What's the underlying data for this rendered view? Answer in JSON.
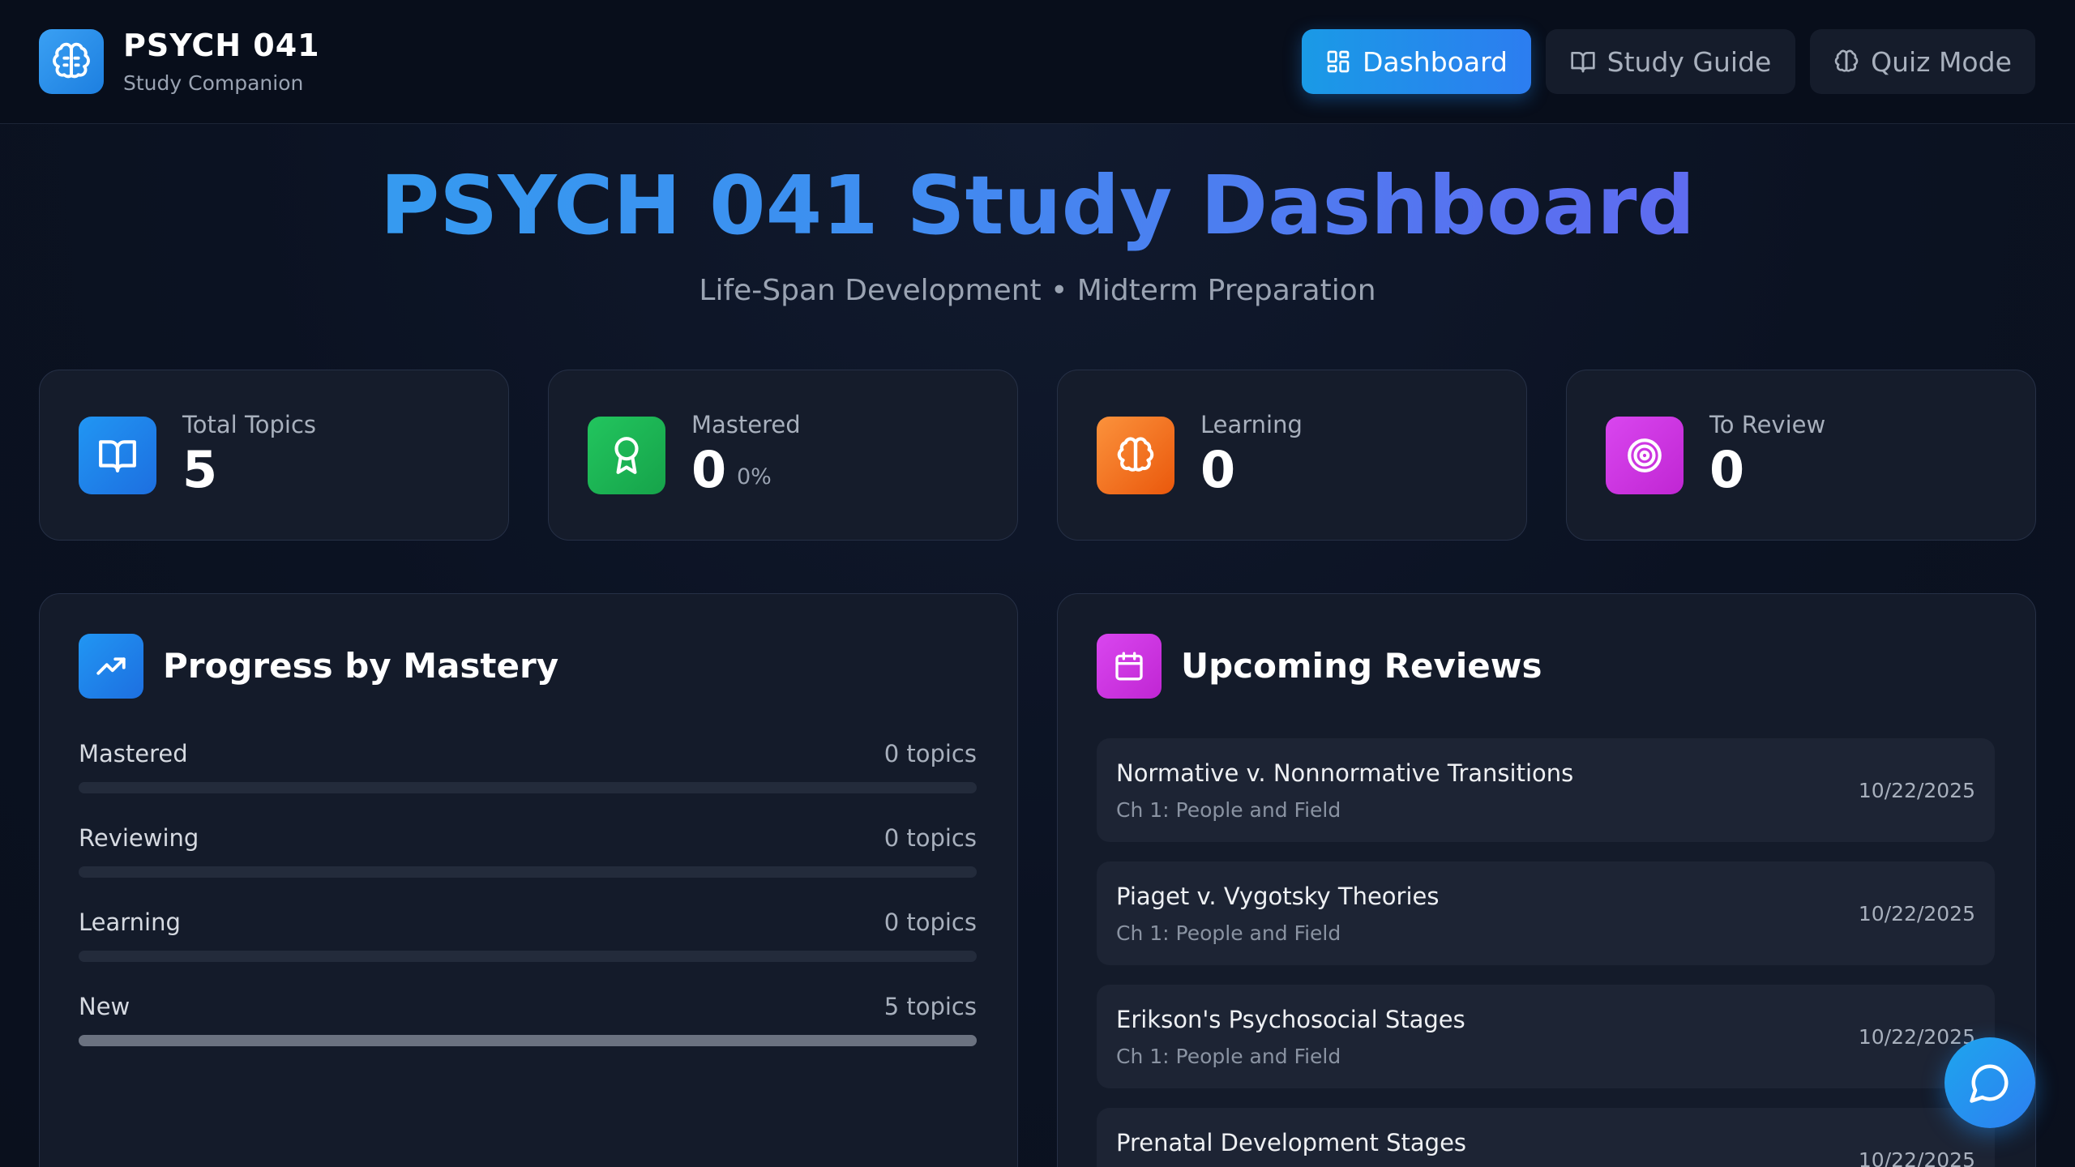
{
  "brand": {
    "title": "PSYCH 041",
    "subtitle": "Study Companion",
    "icon": "brain-icon"
  },
  "nav": [
    {
      "label": "Dashboard",
      "icon": "grid-icon",
      "active": true
    },
    {
      "label": "Study Guide",
      "icon": "book-open-icon",
      "active": false
    },
    {
      "label": "Quiz Mode",
      "icon": "brain-icon",
      "active": false
    }
  ],
  "hero": {
    "title": "PSYCH 041 Study Dashboard",
    "subtitle": "Life-Span Development • Midterm Preparation"
  },
  "stats": [
    {
      "label": "Total Topics",
      "value": "5",
      "icon": "book-open-icon",
      "color": "#1e88e5"
    },
    {
      "label": "Mastered",
      "value": "0",
      "percent": "0%",
      "icon": "award-icon",
      "color": "#16a34a"
    },
    {
      "label": "Learning",
      "value": "0",
      "icon": "brain-icon",
      "color": "#f97316"
    },
    {
      "label": "To Review",
      "value": "0",
      "icon": "target-icon",
      "color": "#c026d3"
    }
  ],
  "progress": {
    "title": "Progress by Mastery",
    "icon": "trending-up-icon",
    "rows": [
      {
        "label": "Mastered",
        "count": "0 topics",
        "fraction": 0
      },
      {
        "label": "Reviewing",
        "count": "0 topics",
        "fraction": 0
      },
      {
        "label": "Learning",
        "count": "0 topics",
        "fraction": 0
      },
      {
        "label": "New",
        "count": "5 topics",
        "fraction": 1
      }
    ]
  },
  "reviews": {
    "title": "Upcoming Reviews",
    "icon": "calendar-icon",
    "items": [
      {
        "title": "Normative v. Nonnormative Transitions",
        "chapter": "Ch 1: People and Field",
        "date": "10/22/2025"
      },
      {
        "title": "Piaget v. Vygotsky Theories",
        "chapter": "Ch 1: People and Field",
        "date": "10/22/2025"
      },
      {
        "title": "Erikson's Psychosocial Stages",
        "chapter": "Ch 1: People and Field",
        "date": "10/22/2025"
      },
      {
        "title": "Prenatal Development Stages",
        "chapter": "",
        "date": "10/22/2025"
      }
    ]
  },
  "chat": {
    "icon": "chat-bubble-icon"
  }
}
